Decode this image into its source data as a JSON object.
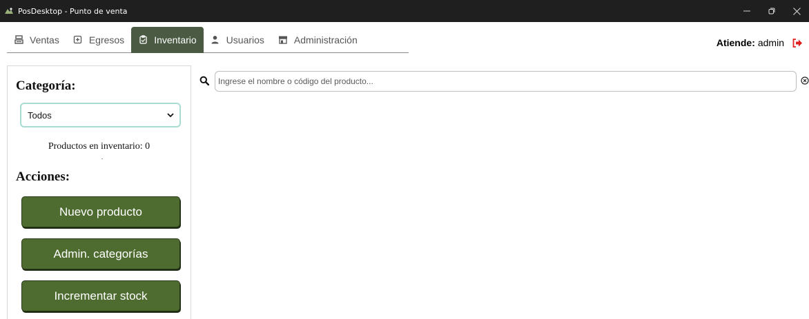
{
  "window": {
    "title": "PosDesktop - Punto de venta"
  },
  "nav": {
    "items": [
      {
        "label": "Ventas",
        "icon": "cash-register-icon"
      },
      {
        "label": "Egresos",
        "icon": "box-icon"
      },
      {
        "label": "Inventario",
        "icon": "clipboard-icon"
      },
      {
        "label": "Usuarios",
        "icon": "user-icon"
      },
      {
        "label": "Administración",
        "icon": "store-icon"
      }
    ],
    "active": "Inventario"
  },
  "header": {
    "attend_label": "Atiende:",
    "user": "admin"
  },
  "sidebar": {
    "category_heading": "Categoría:",
    "category_selected": "Todos",
    "inventory_count_text": "Productos en inventario: 0",
    "actions_heading": "Acciones:",
    "actions": {
      "new_product": "Nuevo producto",
      "admin_categories": "Admin. categorías",
      "increase_stock": "Incrementar stock"
    }
  },
  "search": {
    "placeholder": "Ingrese el nombre o código del producto...",
    "value": ""
  },
  "colors": {
    "nav_active": "#4a5a43",
    "action_button": "#4e6b30",
    "select_border": "#a8dcd2",
    "logout": "#e01f1f"
  }
}
